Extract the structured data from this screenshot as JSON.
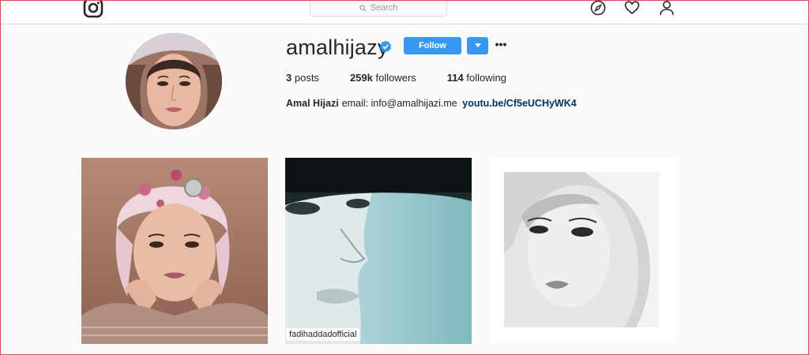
{
  "topbar": {
    "logo_icon": "instagram-logo-icon",
    "search": {
      "placeholder": "Search",
      "icon": "search-icon"
    },
    "nav_icons": [
      "compass-icon",
      "heart-icon",
      "user-icon"
    ]
  },
  "profile": {
    "username": "amalhijazy",
    "verified": true,
    "follow_label": "Follow",
    "dropdown_icon": "caret-down-icon",
    "more_label": "•••",
    "stats": {
      "posts_count": "3",
      "posts_label": "posts",
      "followers_count": "259k",
      "followers_label": "followers",
      "following_count": "114",
      "following_label": "following"
    },
    "bio": {
      "full_name": "Amal Hijazi",
      "text": "email: info@amalhijazi.me",
      "link": "youtu.be/Cf5eUCHyWK4"
    }
  },
  "posts": [
    {
      "tag": ""
    },
    {
      "tag": "fadihaddadofficial"
    },
    {
      "tag": ""
    }
  ],
  "colors": {
    "accent": "#3897f0",
    "link": "#003569",
    "border": "#d0484b"
  }
}
